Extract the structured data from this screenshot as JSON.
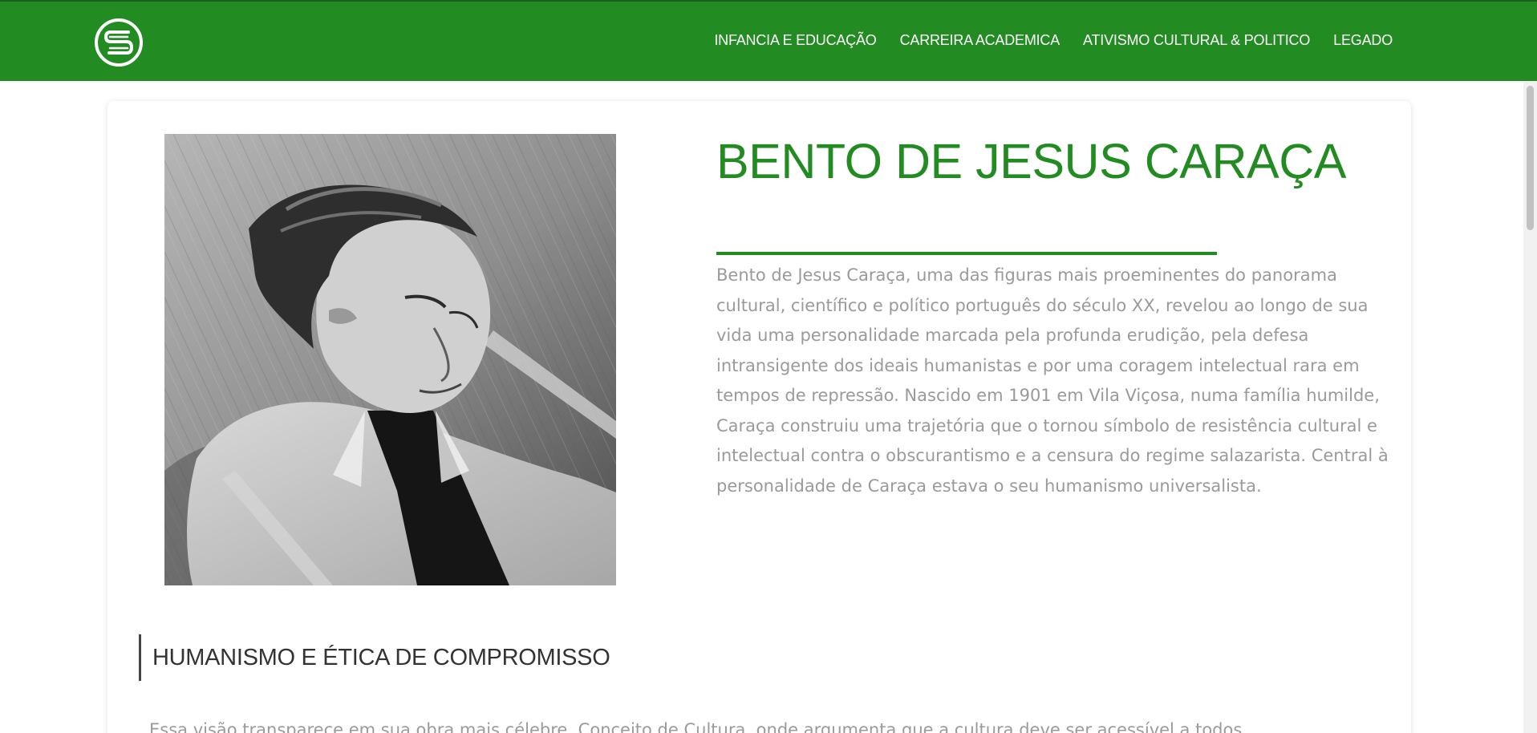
{
  "navbar": {
    "logo_icon": "circular-s-logo-icon",
    "background_color": "#228b22",
    "links": [
      "INFANCIA E EDUCAÇÃO",
      "CARREIRA ACADEMICA",
      "ATIVISMO CULTURAL & POLITICO",
      "LEGADO"
    ]
  },
  "hero": {
    "portrait_icon": "black-and-white-portrait-photo",
    "title": "BENTO DE JESUS CARAÇA",
    "accent_color": "#228b22",
    "intro": "Bento de Jesus Caraça, uma das figuras mais proeminentes do panorama cultural, científico e político português do século XX, revelou ao longo de sua vida uma personalidade marcada pela profunda erudição, pela defesa intransigente dos ideais humanistas e por uma coragem intelectual rara em tempos de repressão. Nascido em 1901 em Vila Viçosa, numa família humilde, Caraça construiu uma trajetória que o tornou símbolo de resistência cultural e intelectual contra o obscurantismo e a censura do regime salazarista. Central à personalidade de Caraça estava o seu humanismo universalista."
  },
  "section": {
    "heading": "HUMANISMO E ÉTICA DE COMPROMISSO",
    "text": "Essa visão transparece em sua obra mais célebre, Conceito de Cultura, onde argumenta que a cultura deve ser acessível a todos"
  }
}
